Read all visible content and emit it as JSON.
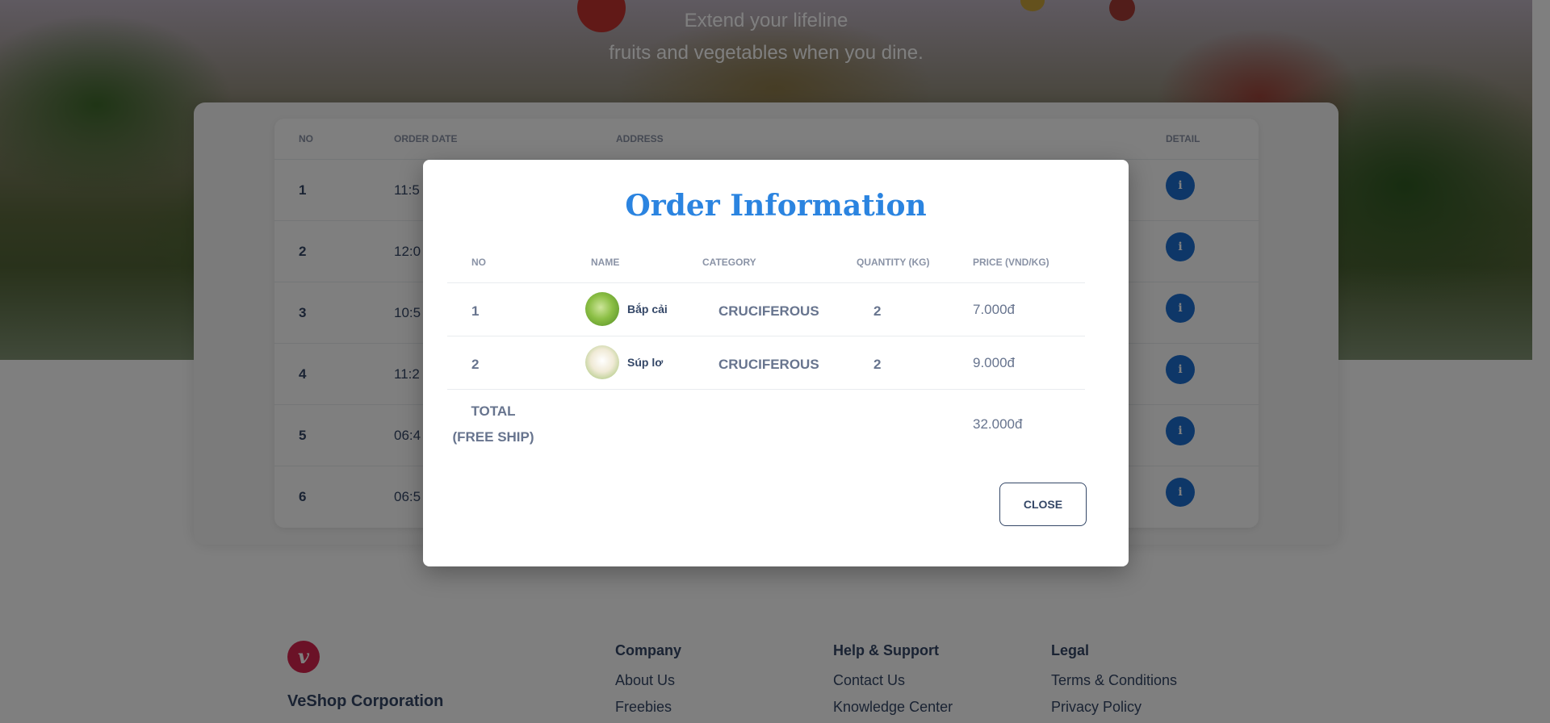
{
  "hero": {
    "line1": "Extend your lifeline",
    "line2": "fruits and vegetables when you dine."
  },
  "orders_table": {
    "headers": {
      "no": "NO",
      "order_date": "ORDER DATE",
      "address": "ADDRESS",
      "detail": "DETAIL"
    },
    "rows": [
      {
        "no": "1",
        "date": "11:5"
      },
      {
        "no": "2",
        "date": "12:0"
      },
      {
        "no": "3",
        "date": "10:5"
      },
      {
        "no": "4",
        "date": "11:2"
      },
      {
        "no": "5",
        "date": "06:4"
      },
      {
        "no": "6",
        "date": "06:5"
      }
    ],
    "detail_icon": "info-icon",
    "accent": "#1c6fd1"
  },
  "modal": {
    "title": "Order Information",
    "headers": {
      "no": "NO",
      "name": "NAME",
      "category": "CATEGORY",
      "quantity": "QUANTITY (KG)",
      "price": "PRICE (VND/KG)"
    },
    "items": [
      {
        "no": "1",
        "name": "Bắp cải",
        "category": "CRUCIFEROUS",
        "quantity": "2",
        "price": "7.000đ",
        "thumb_icon": "cabbage-thumbnail"
      },
      {
        "no": "2",
        "name": "Súp lơ",
        "category": "CRUCIFEROUS",
        "quantity": "2",
        "price": "9.000đ",
        "thumb_icon": "cauliflower-thumbnail"
      }
    ],
    "total_label_1": "TOTAL",
    "total_label_2": "(FREE SHIP)",
    "total_value": "32.000đ",
    "close_label": "CLOSE",
    "title_color": "#2b84e0"
  },
  "footer": {
    "logo_letter": "v",
    "corp_name": "VeShop Corporation",
    "company": {
      "title": "Company",
      "links": [
        "About Us",
        "Freebies"
      ]
    },
    "help": {
      "title": "Help & Support",
      "links": [
        "Contact Us",
        "Knowledge Center"
      ]
    },
    "legal": {
      "title": "Legal",
      "links": [
        "Terms & Conditions",
        "Privacy Policy"
      ]
    },
    "brand_color": "#d6244e"
  }
}
